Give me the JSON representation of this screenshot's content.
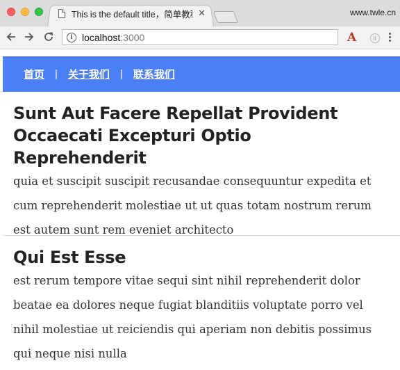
{
  "browser": {
    "tab_title": "This is the default title，简单教程",
    "site_domain": "www.twle.cn",
    "url_host": "localhost",
    "url_port": ":3000",
    "extension_a": "A"
  },
  "nav": {
    "items": [
      "首页",
      "关于我们",
      "联系我们"
    ],
    "separator": "|",
    "accent_color": "#4a7ff5"
  },
  "posts": [
    {
      "title": "Sunt Aut Facere Repellat Provident Occaecati Excepturi Optio Reprehenderit",
      "body": "quia et suscipit suscipit recusandae consequuntur expedita et cum reprehenderit molestiae ut ut quas totam nostrum rerum est autem sunt rem eveniet architecto"
    },
    {
      "title": "Qui Est Esse",
      "body": "est rerum tempore vitae sequi sint nihil reprehenderit dolor beatae ea dolores neque fugiat blanditiis voluptate porro vel nihil molestiae ut reiciendis qui aperiam non debitis possimus qui neque nisi nulla"
    }
  ],
  "icons": {
    "back": "arrow-left-icon",
    "forward": "arrow-right-icon",
    "reload": "reload-icon",
    "info": "info-icon",
    "menu": "more-vertical-icon"
  }
}
